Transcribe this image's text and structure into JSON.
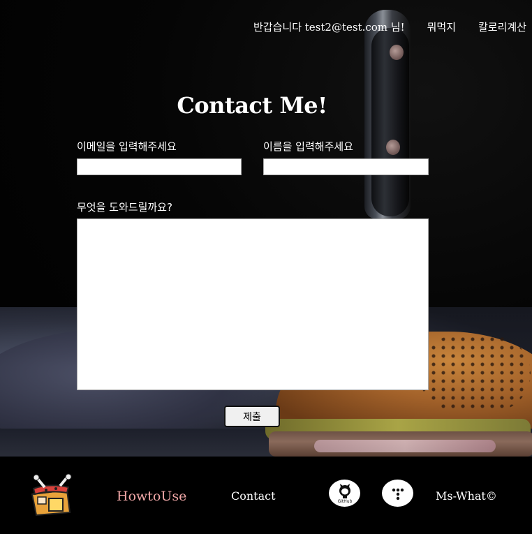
{
  "nav": {
    "greeting": "반갑습니다 test2@test.com 님!",
    "links": [
      "뭐먹지",
      "칼로리계산"
    ]
  },
  "form": {
    "title": "Contact Me!",
    "email_label": "이메일을 입력해주세요",
    "email_value": "",
    "name_label": "이름을 입력해주세요",
    "name_value": "",
    "message_label": "무엇을 도와드릴까요?",
    "message_value": "",
    "submit_label": "제출"
  },
  "footer": {
    "logo_icon": "food-box-logo-icon",
    "howto_label": "HowtoUse",
    "contact_label": "Contact",
    "github_icon": "github-icon",
    "tistory_icon": "tistory-icon",
    "copyright": "Ms-What©"
  },
  "colors": {
    "howto_link": "#f2a8a8",
    "background": "#000000",
    "text": "#ffffff"
  }
}
